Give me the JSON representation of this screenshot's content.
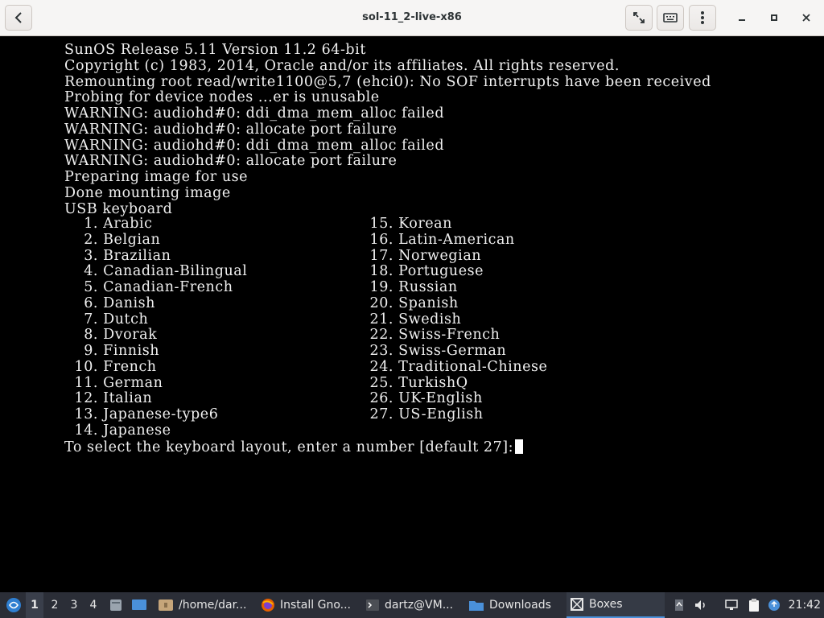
{
  "window": {
    "title": "sol-11_2-live-x86"
  },
  "console": {
    "boot_lines": [
      "SunOS Release 5.11 Version 11.2 64-bit",
      "Copyright (c) 1983, 2014, Oracle and/or its affiliates. All rights reserved.",
      "Remounting root read/write1100@5,7 (ehci0): No SOF interrupts have been received",
      "Probing for device nodes ...er is unusable",
      "WARNING: audiohd#0: ddi_dma_mem_alloc failed",
      "WARNING: audiohd#0: allocate port failure",
      "WARNING: audiohd#0: ddi_dma_mem_alloc failed",
      "WARNING: audiohd#0: allocate port failure",
      "Preparing image for use",
      "Done mounting image",
      "USB keyboard"
    ],
    "keyboards_left": [
      {
        "num": "1.",
        "name": "Arabic"
      },
      {
        "num": "2.",
        "name": "Belgian"
      },
      {
        "num": "3.",
        "name": "Brazilian"
      },
      {
        "num": "4.",
        "name": "Canadian-Bilingual"
      },
      {
        "num": "5.",
        "name": "Canadian-French"
      },
      {
        "num": "6.",
        "name": "Danish"
      },
      {
        "num": "7.",
        "name": "Dutch"
      },
      {
        "num": "8.",
        "name": "Dvorak"
      },
      {
        "num": "9.",
        "name": "Finnish"
      },
      {
        "num": "10.",
        "name": "French"
      },
      {
        "num": "11.",
        "name": "German"
      },
      {
        "num": "12.",
        "name": "Italian"
      },
      {
        "num": "13.",
        "name": "Japanese-type6"
      },
      {
        "num": "14.",
        "name": "Japanese"
      }
    ],
    "keyboards_right": [
      {
        "num": "15.",
        "name": "Korean"
      },
      {
        "num": "16.",
        "name": "Latin-American"
      },
      {
        "num": "17.",
        "name": "Norwegian"
      },
      {
        "num": "18.",
        "name": "Portuguese"
      },
      {
        "num": "19.",
        "name": "Russian"
      },
      {
        "num": "20.",
        "name": "Spanish"
      },
      {
        "num": "21.",
        "name": "Swedish"
      },
      {
        "num": "22.",
        "name": "Swiss-French"
      },
      {
        "num": "23.",
        "name": "Swiss-German"
      },
      {
        "num": "24.",
        "name": "Traditional-Chinese"
      },
      {
        "num": "25.",
        "name": "TurkishQ"
      },
      {
        "num": "26.",
        "name": "UK-English"
      },
      {
        "num": "27.",
        "name": "US-English"
      }
    ],
    "prompt": "To select the keyboard layout, enter a number [default 27]:"
  },
  "taskbar": {
    "workspaces": [
      "1",
      "2",
      "3",
      "4"
    ],
    "active_workspace": "1",
    "tasks": [
      {
        "label": "/home/dar...",
        "icon": "folder-icon"
      },
      {
        "label": "Install Gno...",
        "icon": "firefox-icon"
      },
      {
        "label": "dartz@VM...",
        "icon": "terminal-icon"
      },
      {
        "label": "Downloads",
        "icon": "folder-icon"
      },
      {
        "label": "Boxes",
        "icon": "boxes-icon"
      }
    ],
    "clock": "21:42"
  },
  "colors": {
    "console_bg": "#000000",
    "console_fg": "#f0f0f0",
    "headerbar_bg": "#f6f5f4",
    "taskbar_bg": "#2b2e37",
    "accent": "#4a90d9"
  }
}
